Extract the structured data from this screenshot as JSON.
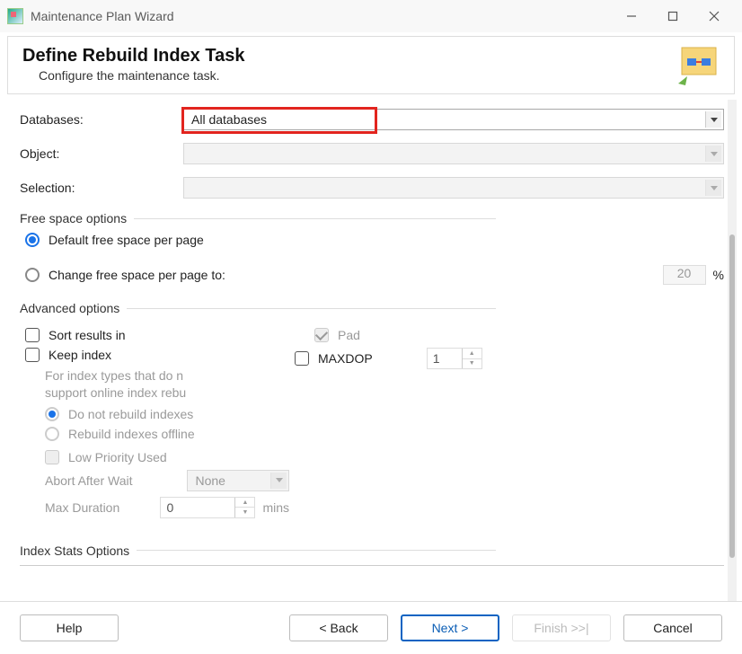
{
  "window": {
    "title": "Maintenance Plan Wizard"
  },
  "header": {
    "title": "Define Rebuild Index Task",
    "subtitle": "Configure the maintenance task."
  },
  "fields": {
    "databases_label": "Databases:",
    "databases_value": "All databases",
    "object_label": "Object:",
    "object_value": "",
    "selection_label": "Selection:",
    "selection_value": ""
  },
  "groups": {
    "free_space": "Free space options",
    "advanced": "Advanced options",
    "index_stats": "Index Stats Options"
  },
  "free_space": {
    "default_option": "Default free space per page",
    "change_option": "Change free space per page to:",
    "change_value": "20",
    "change_unit": "%"
  },
  "advanced": {
    "sort_results": "Sort results in",
    "pad": "Pad",
    "keep_index": "Keep index",
    "maxdop_label": "MAXDOP",
    "maxdop_value": "1",
    "note_line1": "For index types that do n",
    "note_line2": "support online index rebu",
    "opt_do_not_rebuild": "Do not rebuild indexes",
    "opt_rebuild_offline": "Rebuild indexes offline",
    "low_priority": "Low Priority Used",
    "abort_after_wait_label": "Abort After Wait",
    "abort_after_wait_value": "None",
    "max_duration_label": "Max Duration",
    "max_duration_value": "0",
    "max_duration_unit": "mins"
  },
  "footer": {
    "help": "Help",
    "back": "< Back",
    "next": "Next >",
    "finish": "Finish >>|",
    "cancel": "Cancel"
  }
}
